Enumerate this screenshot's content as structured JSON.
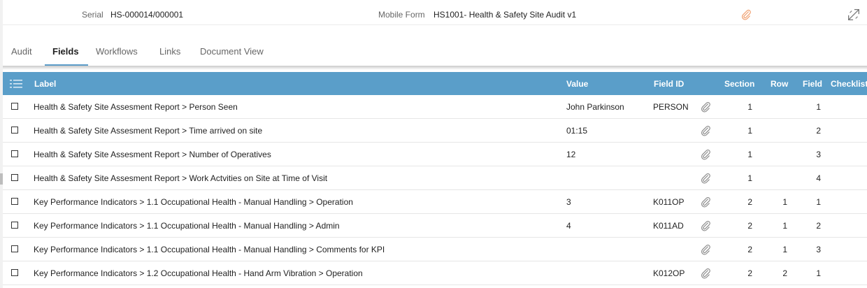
{
  "header": {
    "serial_label": "Serial",
    "serial_value": "HS-000014/000001",
    "form_label": "Mobile Form",
    "form_value": "HS1001- Health & Safety Site Audit v1",
    "attachment_icon": "paperclip-icon",
    "expand_icon": "expand-icon"
  },
  "tabs": [
    {
      "label": "Audit"
    },
    {
      "label": "Fields"
    },
    {
      "label": "Workflows"
    },
    {
      "label": "Links"
    },
    {
      "label": "Document View"
    }
  ],
  "active_tab": "Fields",
  "table": {
    "columns": {
      "label": "Label",
      "value": "Value",
      "field_id": "Field ID",
      "section": "Section",
      "row": "Row",
      "field": "Field",
      "checklist": "Checklist"
    },
    "rows": [
      {
        "label": "Health & Safety Site Assesment Report > Person Seen",
        "value": "John Parkinson",
        "field_id": "PERSON",
        "section": "1",
        "row": "",
        "field": "1"
      },
      {
        "label": "Health & Safety Site Assesment Report > Time arrived on site",
        "value": "01:15",
        "field_id": "",
        "section": "1",
        "row": "",
        "field": "2"
      },
      {
        "label": "Health & Safety Site Assesment Report > Number of Operatives",
        "value": "12",
        "field_id": "",
        "section": "1",
        "row": "",
        "field": "3"
      },
      {
        "label": "Health & Safety Site Assesment Report > Work Actvities on Site at Time of Visit",
        "value": "",
        "field_id": "",
        "section": "1",
        "row": "",
        "field": "4"
      },
      {
        "label": "Key Performance Indicators > 1.1 Occupational Health - Manual Handling > Operation",
        "value": "3",
        "field_id": "K011OP",
        "section": "2",
        "row": "1",
        "field": "1"
      },
      {
        "label": "Key Performance Indicators > 1.1 Occupational Health - Manual Handling > Admin",
        "value": "4",
        "field_id": "K011AD",
        "section": "2",
        "row": "1",
        "field": "2"
      },
      {
        "label": "Key Performance Indicators > 1.1 Occupational Health - Manual Handling > Comments for KPI",
        "value": "",
        "field_id": "",
        "section": "2",
        "row": "1",
        "field": "3"
      },
      {
        "label": "Key Performance Indicators > 1.2 Occupational Health - Hand Arm Vibration > Operation",
        "value": "",
        "field_id": "K012OP",
        "section": "2",
        "row": "2",
        "field": "1"
      }
    ]
  },
  "colors": {
    "header_bg": "#5a9ec9",
    "active_tab_underline": "#5b9cc8",
    "attachment_accent": "#f0a070"
  }
}
